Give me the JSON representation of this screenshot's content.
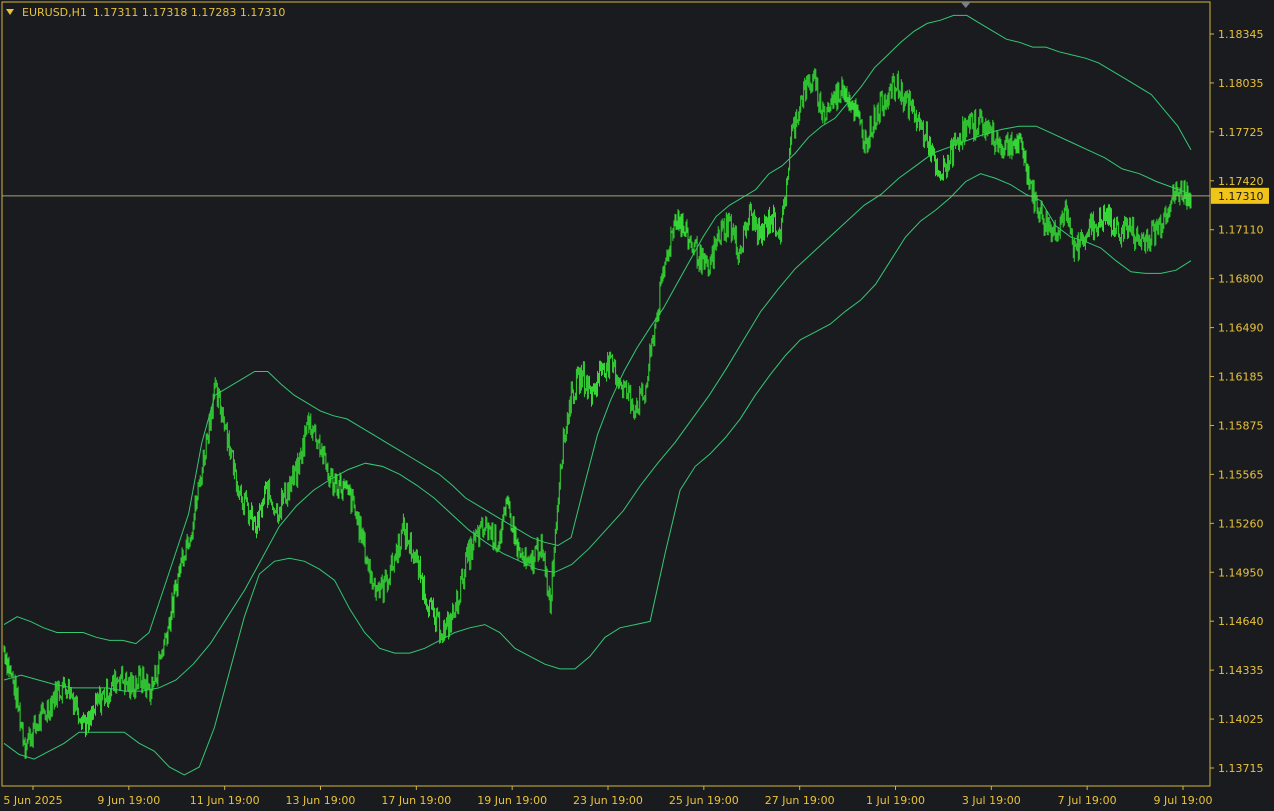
{
  "header": {
    "symbol": "EURUSD,H1",
    "quote": "1.17311 1.17318 1.17283 1.17310"
  },
  "colors": {
    "background": "#1a1b1f",
    "axis": "#d4b43a",
    "axis_text": "#e8c33a",
    "price_bars": "#35d635",
    "bands": "#34c873",
    "current_line": "#a9a07a",
    "price_label_bg": "#f0c419",
    "price_label_text": "#1a1b1f"
  },
  "chart_data": {
    "type": "line",
    "symbol": "EURUSD",
    "timeframe": "H1",
    "y_axis_side": "right",
    "y_ticks": [
      "1.18345",
      "1.18035",
      "1.17725",
      "1.17420",
      "1.17110",
      "1.16800",
      "1.16490",
      "1.16185",
      "1.15875",
      "1.15565",
      "1.15260",
      "1.14950",
      "1.14640",
      "1.14335",
      "1.14025",
      "1.13715"
    ],
    "x_ticks": [
      "5 Jun 2025",
      "9 Jun 19:00",
      "11 Jun 19:00",
      "13 Jun 19:00",
      "17 Jun 19:00",
      "19 Jun 19:00",
      "23 Jun 19:00",
      "25 Jun 19:00",
      "27 Jun 19:00",
      "1 Jul 19:00",
      "3 Jul 19:00",
      "7 Jul 19:00",
      "9 Jul 19:00"
    ],
    "ylim": [
      1.1358,
      1.18535
    ],
    "current_price": "1.17310",
    "current_price_value": 1.1731,
    "series": [
      {
        "kind": "price",
        "values": [
          1.1445,
          1.142,
          1.1385,
          1.1395,
          1.1405,
          1.1418,
          1.1422,
          1.1408,
          1.1395,
          1.1412,
          1.1418,
          1.1428,
          1.142,
          1.1426,
          1.1418,
          1.1442,
          1.147,
          1.1505,
          1.1525,
          1.1565,
          1.1608,
          1.159,
          1.1555,
          1.1535,
          1.152,
          1.1545,
          1.1532,
          1.1545,
          1.1558,
          1.159,
          1.1575,
          1.1552,
          1.1548,
          1.154,
          1.1518,
          1.1488,
          1.1482,
          1.1498,
          1.152,
          1.1505,
          1.1482,
          1.1462,
          1.1455,
          1.147,
          1.15,
          1.1515,
          1.1522,
          1.1512,
          1.1535,
          1.1505,
          1.1495,
          1.1512,
          1.1475,
          1.1565,
          1.1605,
          1.1618,
          1.1605,
          1.1625,
          1.1622,
          1.161,
          1.1598,
          1.1605,
          1.165,
          1.169,
          1.172,
          1.1705,
          1.1695,
          1.1682,
          1.1705,
          1.1715,
          1.1695,
          1.172,
          1.1705,
          1.1718,
          1.1708,
          1.177,
          1.1795,
          1.1805,
          1.1782,
          1.1792,
          1.18,
          1.1785,
          1.1765,
          1.1782,
          1.1795,
          1.18,
          1.179,
          1.1778,
          1.1765,
          1.174,
          1.1755,
          1.177,
          1.1775,
          1.1778,
          1.177,
          1.1762,
          1.1765,
          1.176,
          1.173,
          1.1715,
          1.1708,
          1.172,
          1.1695,
          1.171,
          1.1712,
          1.1718,
          1.1708,
          1.1712,
          1.1702,
          1.1705,
          1.1712,
          1.1728,
          1.1734,
          1.1731
        ]
      },
      {
        "kind": "band-upper",
        "values": [
          1.146,
          1.1465,
          1.1462,
          1.1458,
          1.1455,
          1.1455,
          1.1455,
          1.1452,
          1.145,
          1.145,
          1.1448,
          1.1455,
          1.148,
          1.1505,
          1.153,
          1.1575,
          1.1605,
          1.161,
          1.1615,
          1.162,
          1.162,
          1.1612,
          1.1605,
          1.16,
          1.1595,
          1.1592,
          1.159,
          1.1585,
          1.158,
          1.1575,
          1.157,
          1.1565,
          1.156,
          1.1555,
          1.1548,
          1.154,
          1.1535,
          1.153,
          1.1525,
          1.152,
          1.1515,
          1.1512,
          1.151,
          1.1515,
          1.1548,
          1.158,
          1.1602,
          1.162,
          1.1635,
          1.1648,
          1.166,
          1.1675,
          1.169,
          1.1705,
          1.1718,
          1.1725,
          1.173,
          1.1735,
          1.1745,
          1.175,
          1.1758,
          1.1768,
          1.1775,
          1.178,
          1.179,
          1.18,
          1.1812,
          1.182,
          1.1828,
          1.1835,
          1.184,
          1.1842,
          1.1845,
          1.1845,
          1.184,
          1.1835,
          1.183,
          1.1828,
          1.1825,
          1.1825,
          1.1822,
          1.182,
          1.1818,
          1.1815,
          1.181,
          1.1805,
          1.18,
          1.1795,
          1.1785,
          1.1775,
          1.176
        ]
      },
      {
        "kind": "band-middle",
        "values": [
          1.1425,
          1.1428,
          1.1425,
          1.1422,
          1.142,
          1.142,
          1.142,
          1.1418,
          1.1418,
          1.142,
          1.1425,
          1.1435,
          1.1448,
          1.1465,
          1.1482,
          1.1502,
          1.1522,
          1.1535,
          1.1545,
          1.1552,
          1.1558,
          1.1562,
          1.156,
          1.1555,
          1.1548,
          1.154,
          1.153,
          1.152,
          1.1512,
          1.1505,
          1.15,
          1.1495,
          1.1493,
          1.1498,
          1.1508,
          1.152,
          1.1532,
          1.1548,
          1.1562,
          1.1575,
          1.159,
          1.1605,
          1.1622,
          1.164,
          1.1658,
          1.1672,
          1.1685,
          1.1695,
          1.1705,
          1.1715,
          1.1725,
          1.1732,
          1.1742,
          1.175,
          1.1758,
          1.1762,
          1.1766,
          1.177,
          1.1773,
          1.1775,
          1.1775,
          1.177,
          1.1765,
          1.176,
          1.1755,
          1.1748,
          1.1745,
          1.174,
          1.1736,
          1.1732
        ]
      },
      {
        "kind": "band-lower",
        "values": [
          1.1385,
          1.1378,
          1.1375,
          1.138,
          1.1385,
          1.1392,
          1.1392,
          1.1392,
          1.1392,
          1.1385,
          1.138,
          1.137,
          1.1365,
          1.137,
          1.1395,
          1.143,
          1.1465,
          1.1492,
          1.15,
          1.1502,
          1.15,
          1.1495,
          1.1488,
          1.147,
          1.1455,
          1.1445,
          1.1442,
          1.1442,
          1.1445,
          1.145,
          1.1455,
          1.1458,
          1.146,
          1.1455,
          1.1445,
          1.144,
          1.1435,
          1.1432,
          1.1432,
          1.144,
          1.1452,
          1.1458,
          1.146,
          1.1462,
          1.1505,
          1.1545,
          1.156,
          1.1568,
          1.1578,
          1.159,
          1.1605,
          1.1618,
          1.163,
          1.164,
          1.1645,
          1.165,
          1.1658,
          1.1665,
          1.1675,
          1.169,
          1.1705,
          1.1715,
          1.1722,
          1.173,
          1.174,
          1.1745,
          1.1742,
          1.1738,
          1.1732,
          1.1728,
          1.1712,
          1.1705,
          1.1702,
          1.1698,
          1.169,
          1.1683,
          1.1682,
          1.1682,
          1.1684,
          1.169
        ]
      }
    ]
  }
}
